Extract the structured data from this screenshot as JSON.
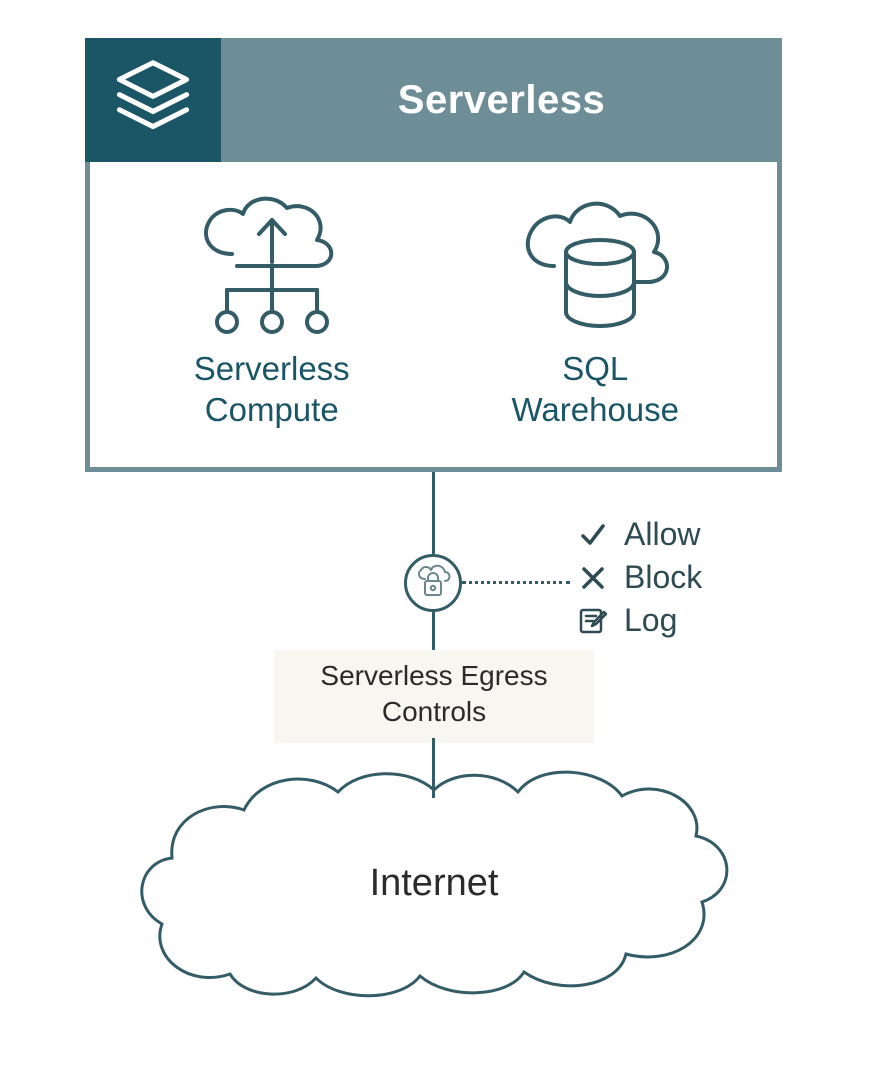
{
  "header": {
    "title": "Serverless"
  },
  "components": {
    "compute": {
      "label_line1": "Serverless",
      "label_line2": "Compute"
    },
    "warehouse": {
      "label_line1": "SQL",
      "label_line2": "Warehouse"
    }
  },
  "egress": {
    "label_line1": "Serverless Egress",
    "label_line2": "Controls"
  },
  "actions": {
    "allow": "Allow",
    "block": "Block",
    "log": "Log"
  },
  "internet": {
    "label": "Internet"
  }
}
